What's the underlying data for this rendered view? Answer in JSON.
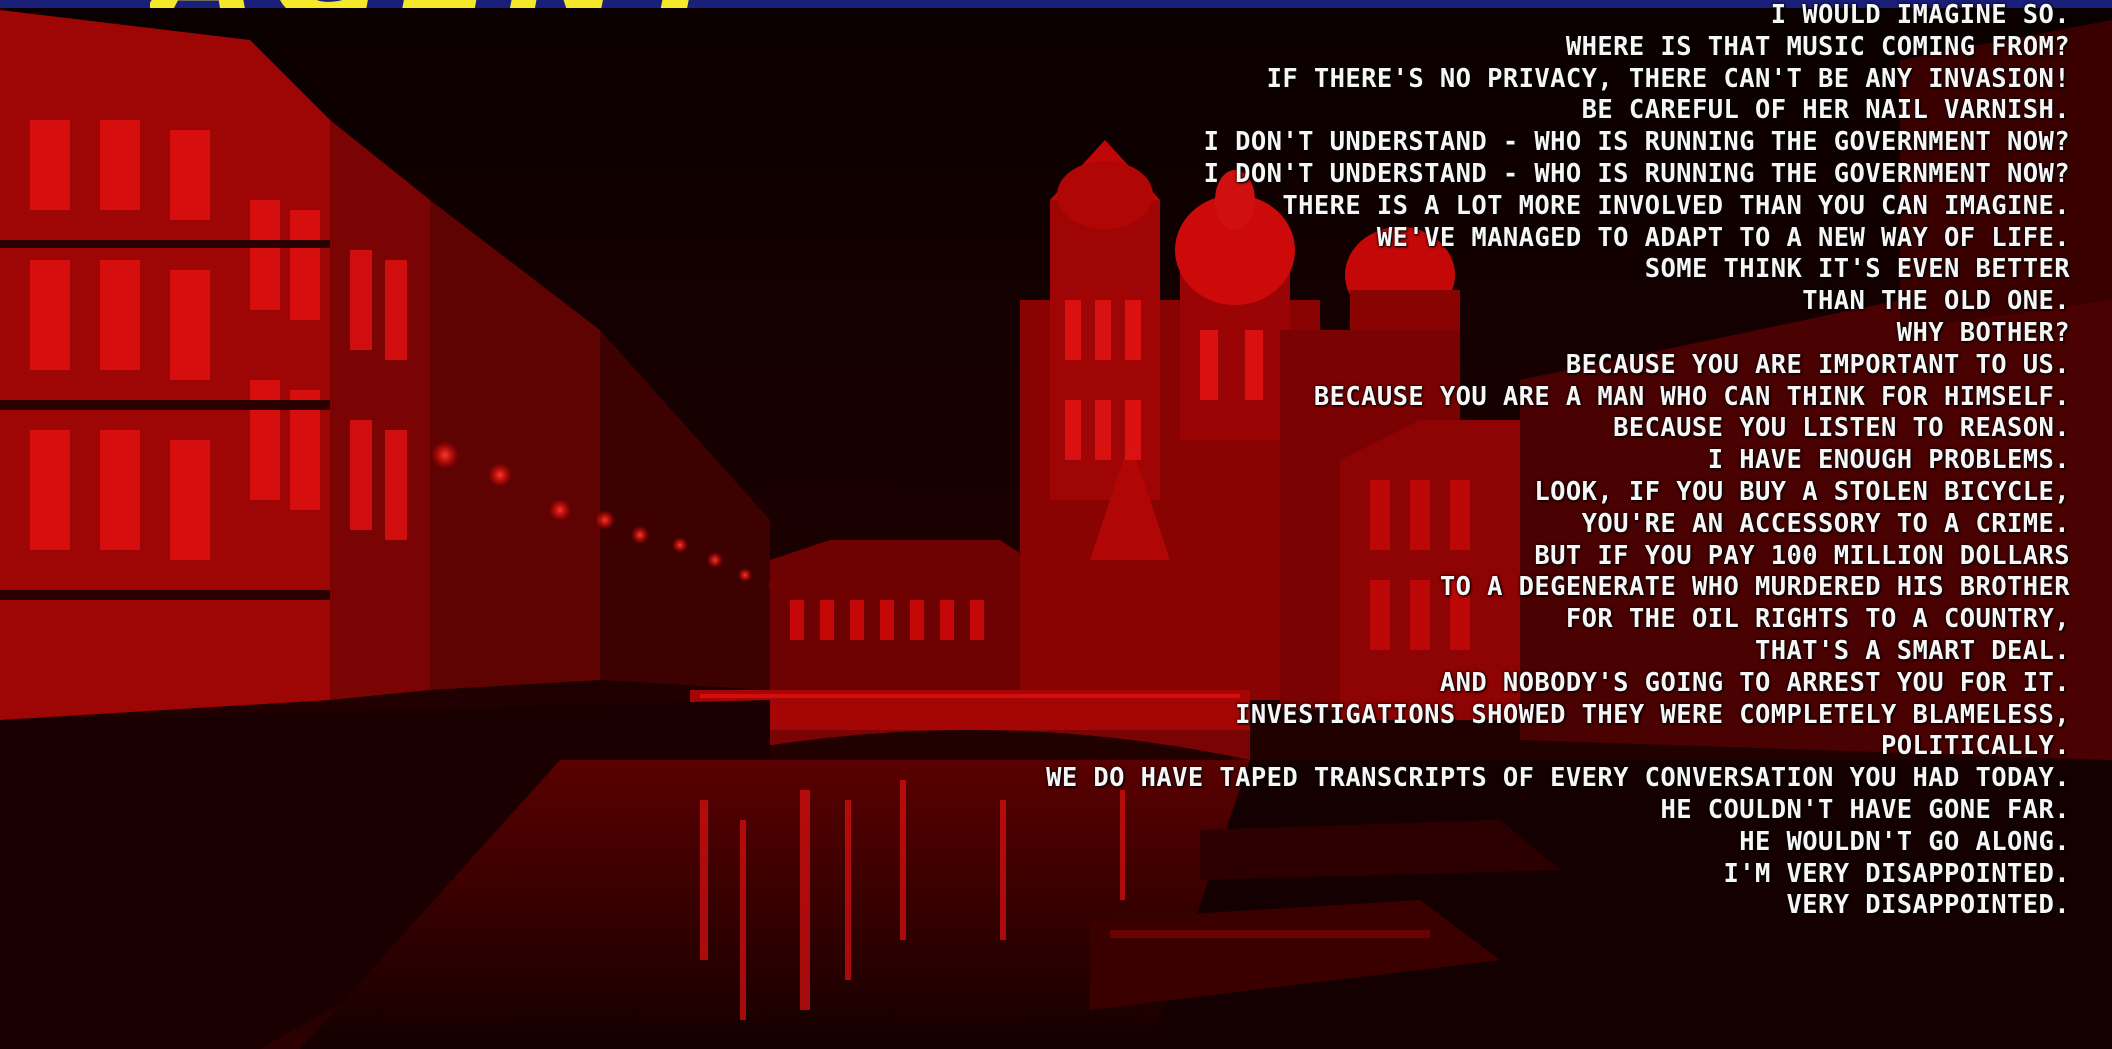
{
  "logo": {
    "text": "AGENT",
    "color": "#f4e82a"
  },
  "subtitles": [
    "I WOULD IMAGINE SO.",
    "WHERE IS THAT MUSIC COMING FROM?",
    "IF THERE'S NO PRIVACY, THERE CAN'T BE ANY INVASION!",
    "BE CAREFUL OF HER NAIL VARNISH.",
    "I DON'T UNDERSTAND - WHO IS RUNNING THE GOVERNMENT NOW?",
    "I DON'T UNDERSTAND - WHO IS RUNNING THE GOVERNMENT NOW?",
    "THERE IS A LOT MORE INVOLVED THAN YOU CAN IMAGINE.",
    "WE'VE MANAGED TO ADAPT TO A NEW WAY OF LIFE.",
    "SOME THINK IT'S EVEN BETTER",
    "THAN THE OLD ONE.",
    "WHY BOTHER?",
    "BECAUSE YOU ARE IMPORTANT TO US.",
    "BECAUSE YOU ARE A MAN WHO CAN THINK FOR HIMSELF.",
    "BECAUSE YOU LISTEN TO REASON.",
    "I HAVE ENOUGH PROBLEMS.",
    "LOOK, IF YOU BUY A STOLEN BICYCLE,",
    "YOU'RE AN ACCESSORY TO A CRIME.",
    "BUT IF YOU PAY 100 MILLION DOLLARS",
    "TO A DEGENERATE WHO MURDERED HIS BROTHER",
    "FOR THE OIL RIGHTS TO A COUNTRY,",
    "THAT'S A SMART DEAL.",
    "AND NOBODY'S GOING TO ARREST YOU FOR IT.",
    "INVESTIGATIONS SHOWED THEY WERE COMPLETELY BLAMELESS,",
    "POLITICALLY.",
    "WE DO HAVE TAPED TRANSCRIPTS OF EVERY CONVERSATION YOU HAD TODAY.",
    "HE COULDN'T HAVE GONE FAR.",
    "HE WOULDN'T GO ALONG.",
    "I'M VERY DISAPPOINTED.",
    "VERY DISAPPOINTED."
  ],
  "colors": {
    "top_bar": "#1a1f7a",
    "tint": "#d40000",
    "subtitle_text": "#f6f6f6"
  }
}
